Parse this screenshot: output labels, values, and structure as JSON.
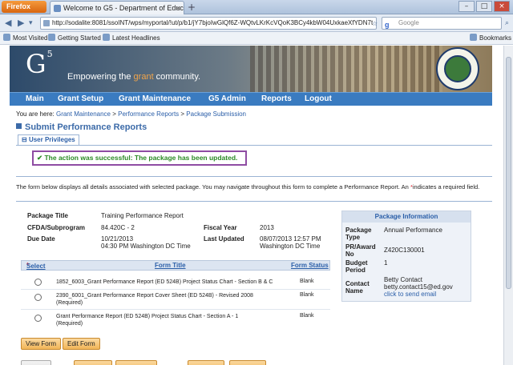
{
  "browser": {
    "app_button": "Firefox",
    "tab_title": "Welcome to G5 - Department of Educati...",
    "url": "http://sodalite:8081/ssoINT/wps/myportal/!ut/p/b1/jY7bjoIwGlQf6Z-WQtvLKrKcVQoK3BCy4kbW04UxkaeXfYDN7t",
    "search_placeholder": "Google",
    "bookmarks": [
      "Most Visited",
      "Getting Started",
      "Latest Headlines"
    ],
    "bookmarks_right": "Bookmarks"
  },
  "banner": {
    "logo": "G",
    "logo_sup": "5",
    "tagline_pre": "Empowering the ",
    "tagline_highlight": "grant",
    "tagline_post": " community."
  },
  "menu": [
    "Main",
    "Grant Setup",
    "Grant Maintenance",
    "G5 Admin",
    "Reports",
    "Logout"
  ],
  "breadcrumb": {
    "prefix": "You are here: ",
    "items": [
      "Grant Maintenance",
      "Performance Reports",
      "Package Submission"
    ],
    "sep": " > "
  },
  "page_title": "Submit Performance Reports",
  "user_privileges_tab": "User Privileges",
  "success_message": "The action was successful: The package has been updated.",
  "intro_text": "The form below displays all details associated with selected package. You may navigate throughout this form to complete a Performance Report.  An ",
  "intro_star": "*",
  "intro_text_end": "indicates a required field.",
  "package": {
    "title_label": "Package Title",
    "title": "Training Performance Report",
    "cfda_label": "CFDA/Subprogram",
    "cfda": "84.420C - 2",
    "fiscal_label": "Fiscal Year",
    "fiscal": "2013",
    "due_label": "Due Date",
    "due_line1": "10/21/2013",
    "due_line2": "04:30 PM Washington DC Time",
    "updated_label": "Last Updated",
    "updated_line1": "08/07/2013 12:57 PM",
    "updated_line2": "Washington DC Time"
  },
  "package_info": {
    "header": "Package Information",
    "type_label": "Package Type",
    "type": "Annual Performance",
    "pr_label": "PR/Award No",
    "pr": "Z420C130001",
    "budget_label": "Budget Period",
    "budget": "1",
    "contact_label": "Contact Name",
    "contact_name": "Betty Contact",
    "contact_email": "betty.contact15@ed.gov",
    "contact_link": "click to send email"
  },
  "forms_table": {
    "col_select": "Select",
    "col_select_star": "*",
    "col_title": "Form Title",
    "col_status": "Form Status",
    "rows": [
      {
        "title": "1852_6003_Grant Performance Report (ED 524B) Project Status Chart - Section B & C",
        "title2": "",
        "status": "Blank"
      },
      {
        "title": "2390_6001_Grant Performance Report Cover Sheet (ED 524B) - Revised 2008",
        "title2": "(Required)",
        "status": "Blank"
      },
      {
        "title": "Grant Performance Report (ED 524B) Project Status Chart - Section A - 1",
        "title2": "(Required)",
        "status": "Blank"
      }
    ]
  },
  "buttons": {
    "view_form": "View Form",
    "edit_form": "Edit Form"
  }
}
